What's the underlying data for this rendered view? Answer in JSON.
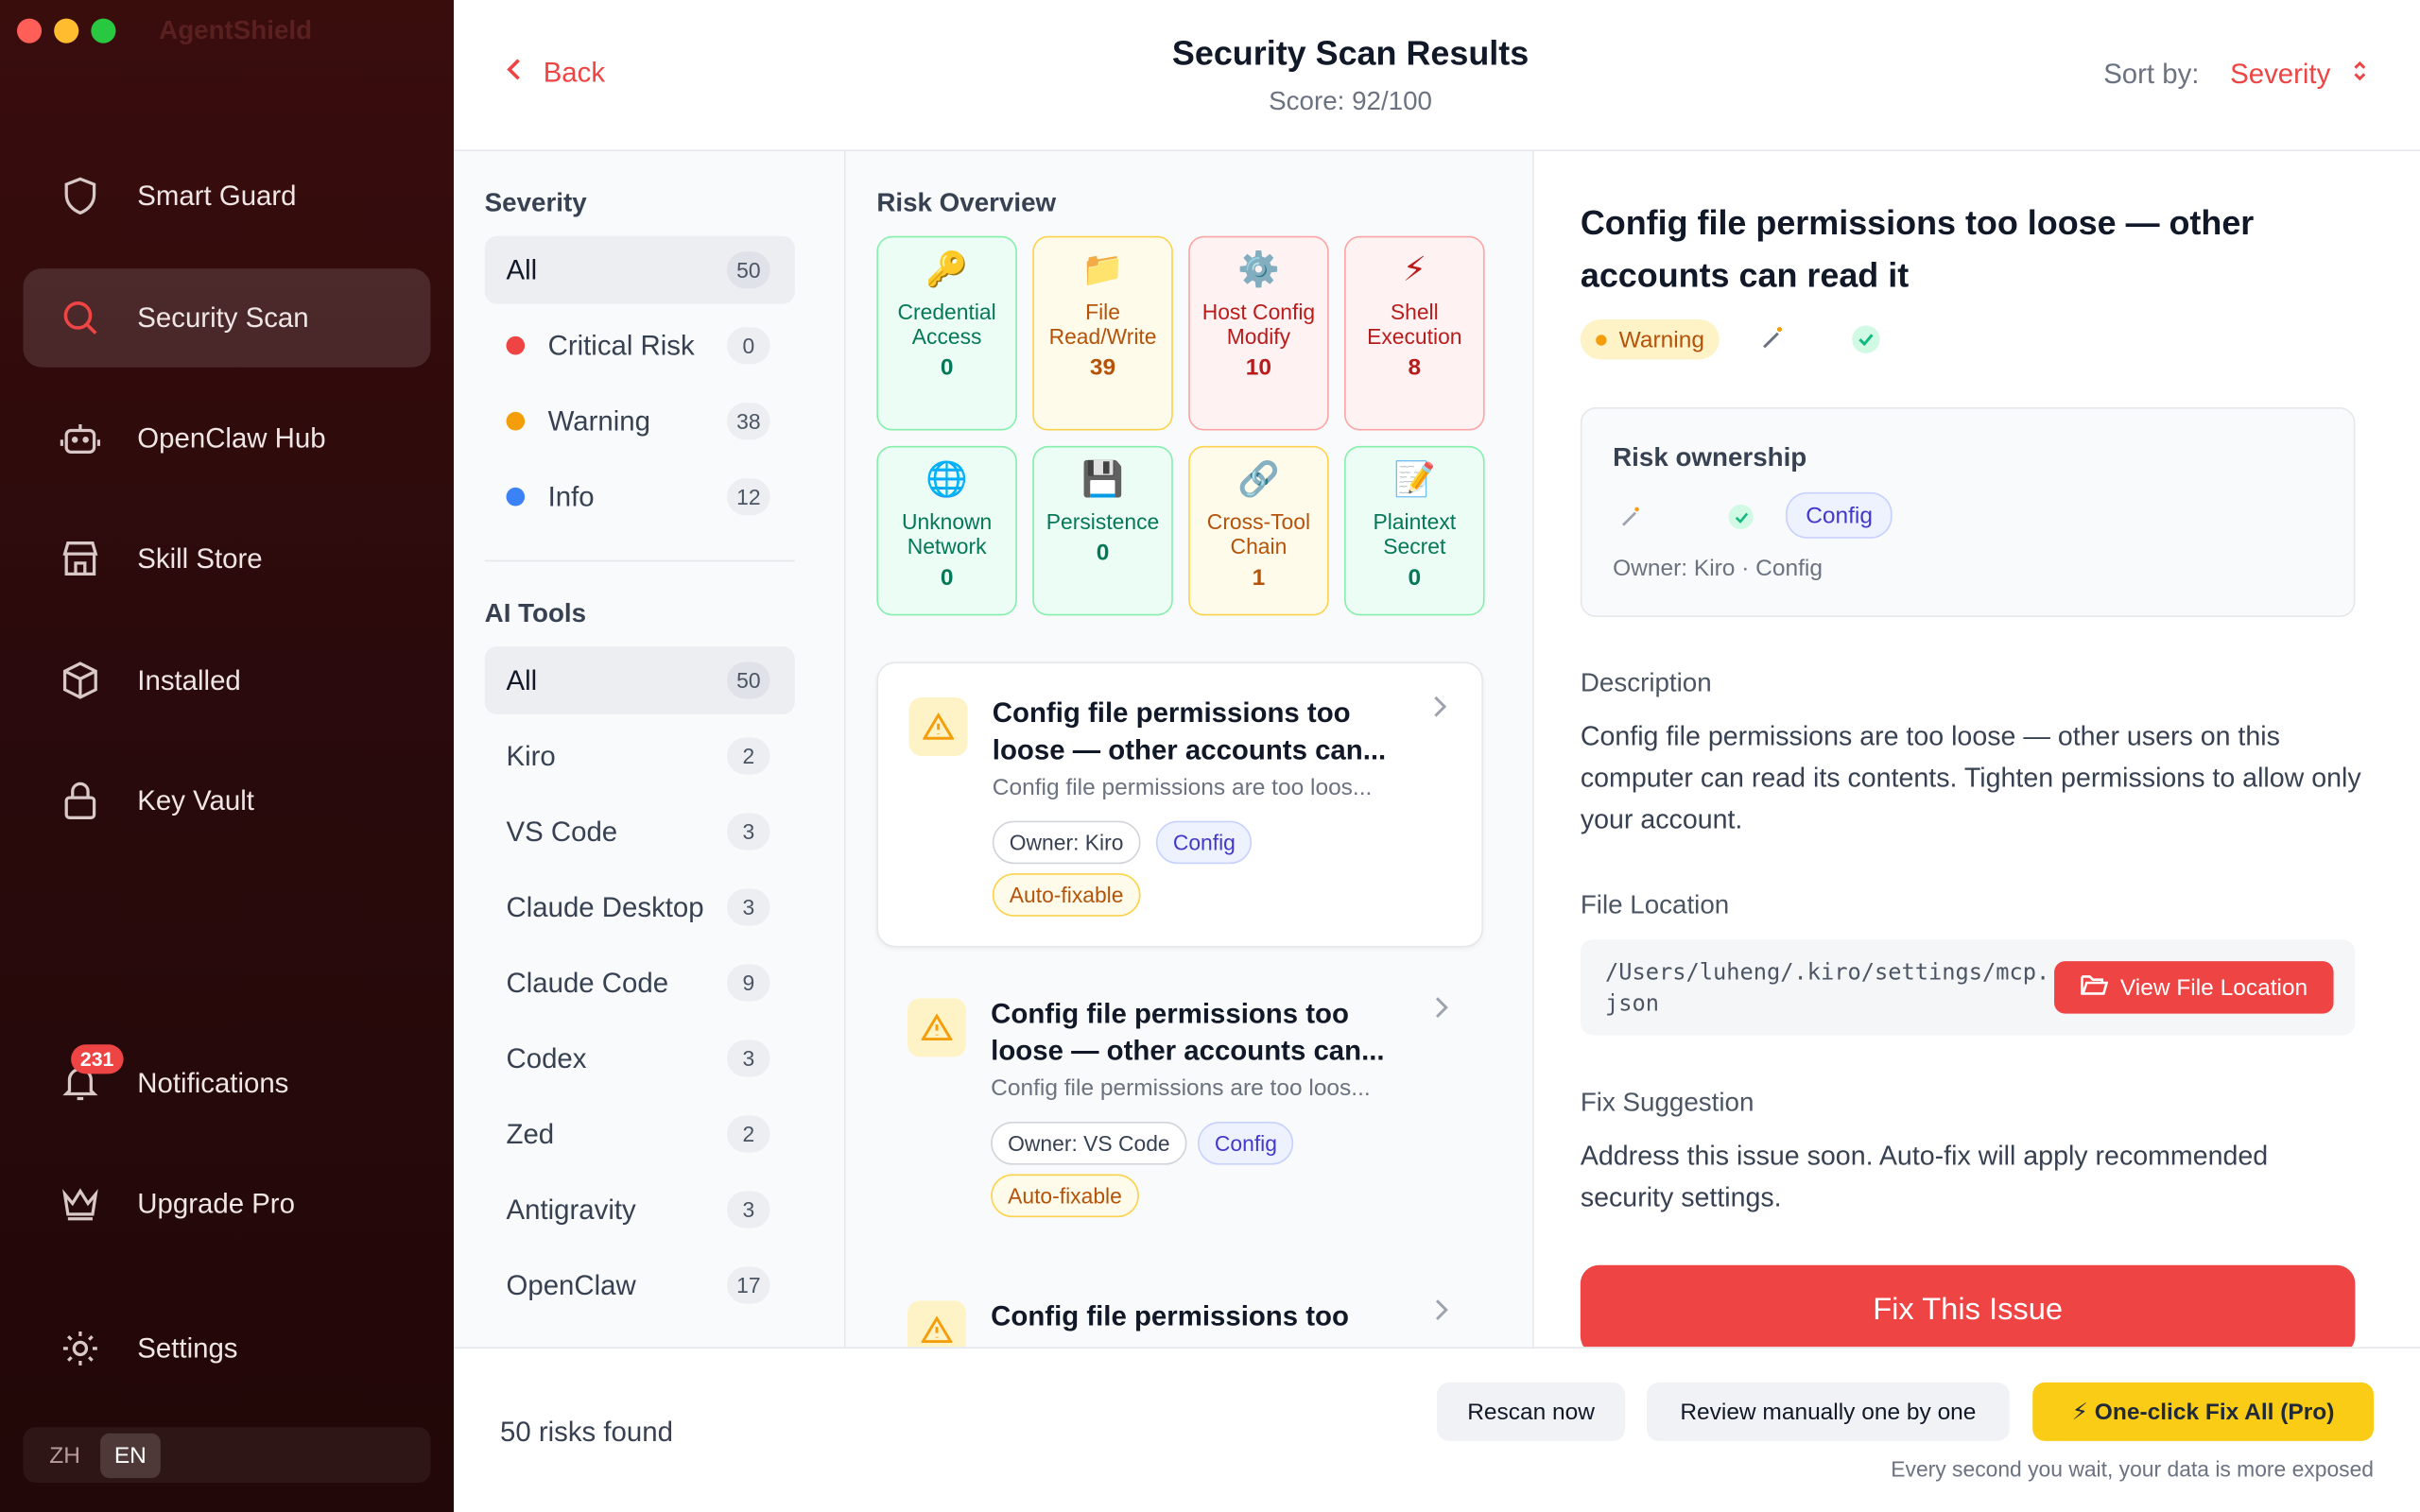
{
  "app": {
    "title": "AgentShield"
  },
  "sidebar": {
    "items": [
      {
        "label": "Smart Guard",
        "icon": "shield-icon"
      },
      {
        "label": "Security Scan",
        "icon": "search-icon",
        "active": true
      },
      {
        "label": "OpenClaw Hub",
        "icon": "robot-icon"
      },
      {
        "label": "Skill Store",
        "icon": "store-icon"
      },
      {
        "label": "Installed",
        "icon": "box-icon"
      },
      {
        "label": "Key Vault",
        "icon": "lock-icon"
      },
      {
        "label": "Notifications",
        "icon": "bell-icon",
        "badge": "231"
      },
      {
        "label": "Upgrade Pro",
        "icon": "crown-icon"
      },
      {
        "label": "Settings",
        "icon": "gear-icon"
      }
    ],
    "lang": {
      "zh": "ZH",
      "en": "EN",
      "selected": "EN"
    }
  },
  "header": {
    "back_label": "Back",
    "title": "Security Scan Results",
    "score": "Score: 92/100",
    "sort_label": "Sort by:",
    "sort_value": "Severity"
  },
  "filters": {
    "severity_heading": "Severity",
    "severity": [
      {
        "label": "All",
        "count": "50",
        "selected": true
      },
      {
        "label": "Critical Risk",
        "count": "0",
        "color": "#ef4444"
      },
      {
        "label": "Warning",
        "count": "38",
        "color": "#f59e0b"
      },
      {
        "label": "Info",
        "count": "12",
        "color": "#3b82f6"
      }
    ],
    "tools_heading": "AI Tools",
    "tools": [
      {
        "label": "All",
        "count": "50",
        "selected": true
      },
      {
        "label": "Kiro",
        "count": "2"
      },
      {
        "label": "VS Code",
        "count": "3"
      },
      {
        "label": "Claude Desktop",
        "count": "3"
      },
      {
        "label": "Claude Code",
        "count": "9"
      },
      {
        "label": "Codex",
        "count": "3"
      },
      {
        "label": "Zed",
        "count": "2"
      },
      {
        "label": "Antigravity",
        "count": "3"
      },
      {
        "label": "OpenClaw",
        "count": "17"
      }
    ]
  },
  "overview": {
    "heading": "Risk Overview",
    "tiles": [
      {
        "emoji": "🔑",
        "label": "Credential Access",
        "count": "0",
        "tone": "green"
      },
      {
        "emoji": "📁",
        "label": "File Read/Write",
        "count": "39",
        "tone": "yellow"
      },
      {
        "emoji": "⚙️",
        "label": "Host Config Modify",
        "count": "10",
        "tone": "red"
      },
      {
        "emoji": "⚡",
        "label": "Shell Execution",
        "count": "8",
        "tone": "red"
      },
      {
        "emoji": "🌐",
        "label": "Unknown Network",
        "count": "0",
        "tone": "green"
      },
      {
        "emoji": "💾",
        "label": "Persistence",
        "count": "0",
        "tone": "green"
      },
      {
        "emoji": "🔗",
        "label": "Cross-Tool Chain",
        "count": "1",
        "tone": "yellow"
      },
      {
        "emoji": "📝",
        "label": "Plaintext Secret",
        "count": "0",
        "tone": "green"
      }
    ]
  },
  "issues": [
    {
      "title": "Config file permissions too loose — other accounts can...",
      "desc": "Config file permissions are too loos...",
      "owner": "Owner: Kiro",
      "category": "Config",
      "fix": "Auto-fixable"
    },
    {
      "title": "Config file permissions too loose — other accounts can...",
      "desc": "Config file permissions are too loos...",
      "owner": "Owner: VS Code",
      "category": "Config",
      "fix": "Auto-fixable"
    },
    {
      "title": "Config file permissions too",
      "desc": "",
      "owner": "",
      "category": "",
      "fix": ""
    }
  ],
  "detail": {
    "title": "Config file permissions too loose — other accounts can read it",
    "severity": "Warning",
    "ownership_heading": "Risk ownership",
    "ownership_tag": "Config",
    "ownership_sub": "Owner: Kiro · Config",
    "desc_heading": "Description",
    "description": "Config file permissions are too loose — other users on this computer can read its contents. Tighten permissions to allow only your account.",
    "location_heading": "File Location",
    "path": "/Users/luheng/.kiro/settings/mcp.json",
    "view_button": "View File Location",
    "fix_heading": "Fix Suggestion",
    "fix_text": "Address this issue soon. Auto-fix will apply recommended security settings.",
    "fix_button": "Fix This Issue"
  },
  "footer": {
    "risks_found": "50 risks found",
    "rescan": "Rescan now",
    "review": "Review manually one by one",
    "oneclick": "⚡ One-click Fix All (Pro)",
    "hint": "Every second you wait, your data is more exposed"
  }
}
